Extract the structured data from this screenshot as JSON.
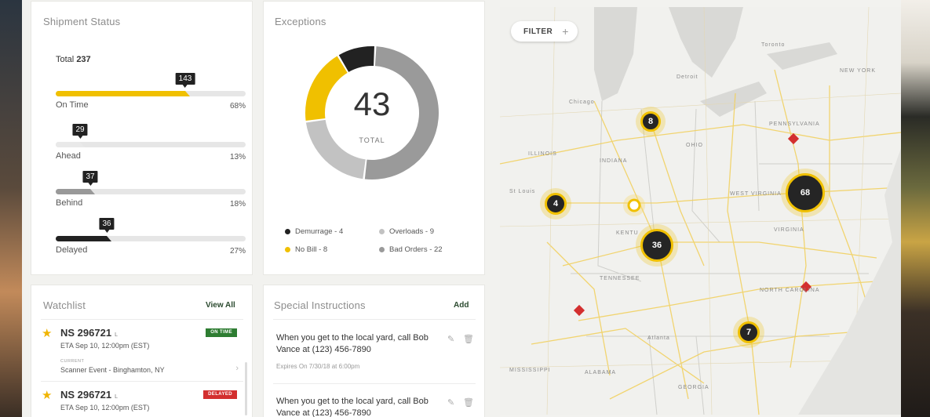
{
  "shipment_status": {
    "title": "Shipment Status",
    "total_label": "Total",
    "total_value": "237",
    "rows": [
      {
        "label": "On Time",
        "count": "143",
        "pct": "68%",
        "fraction": 0.68,
        "color": "#f0c000"
      },
      {
        "label": "Ahead",
        "count": "29",
        "pct": "13%",
        "fraction": 0.13,
        "color": "#e9e9e9"
      },
      {
        "label": "Behind",
        "count": "37",
        "pct": "18%",
        "fraction": 0.18,
        "color": "#999999"
      },
      {
        "label": "Delayed",
        "count": "36",
        "pct": "27%",
        "fraction": 0.27,
        "color": "#222222"
      }
    ]
  },
  "exceptions": {
    "title": "Exceptions",
    "total": "43",
    "total_label": "TOTAL",
    "segments": [
      {
        "label": "Demurrage - 4",
        "value": 4,
        "color": "#222222"
      },
      {
        "label": "Overloads - 9",
        "value": 9,
        "color": "#c2c2c2"
      },
      {
        "label": "No Bill - 8",
        "value": 8,
        "color": "#f0c000"
      },
      {
        "label": "Bad Orders - 22",
        "value": 22,
        "color": "#9a9a9a"
      }
    ]
  },
  "map": {
    "filter_label": "FILTER",
    "filter_icon": "plus-icon",
    "clusters": [
      "8",
      "4",
      "36",
      "68",
      "7"
    ],
    "region_labels": [
      "ILLINOIS",
      "INDIANA",
      "OHIO",
      "PENNSYLVANIA",
      "NEW YORK",
      "TENNESSEE",
      "NORTH CAROLINA",
      "VIRGINIA",
      "MISSISSIPPI",
      "ALABAMA",
      "GEORGIA",
      "KENTU",
      "WEST VIRGINIA"
    ],
    "city_labels": [
      "Chicago",
      "Detroit",
      "St Louis",
      "Toronto",
      "Atlanta"
    ]
  },
  "watchlist": {
    "title": "Watchlist",
    "view_all": "View All",
    "items": [
      {
        "id": "NS 296721",
        "suffix": "L",
        "eta": "ETA Sep 10, 12:00pm (EST)",
        "status": "ON TIME",
        "status_color": "#2e7d32",
        "current_label": "CURRENT",
        "event": "Scanner Event - Binghamton, NY"
      },
      {
        "id": "NS 296721",
        "suffix": "L",
        "eta": "ETA Sep 10, 12:00pm (EST)",
        "status": "DELAYED",
        "status_color": "#d32f2f"
      }
    ]
  },
  "special_instructions": {
    "title": "Special Instructions",
    "add_label": "Add",
    "items": [
      {
        "text": "When you get to the local yard, call Bob Vance at (123) 456-7890",
        "expires": "Expires On 7/30/18 at 6:00pm"
      },
      {
        "text": "When you get to the local yard, call Bob Vance at (123) 456-7890"
      }
    ]
  },
  "colors": {
    "accent": "#f0c000",
    "dark": "#222222",
    "on_time": "#2e7d32",
    "delayed": "#d32f2f"
  }
}
